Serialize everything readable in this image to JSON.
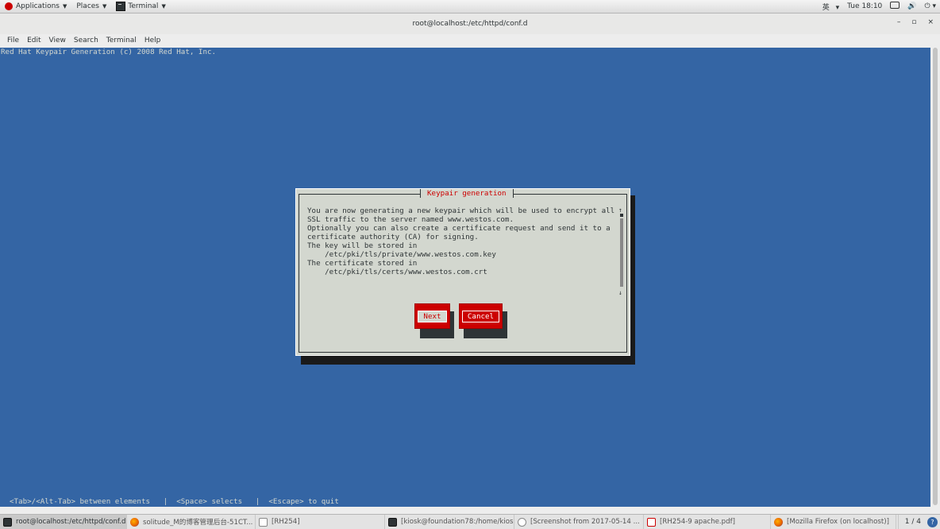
{
  "topbar": {
    "applications": "Applications",
    "places": "Places",
    "terminal": "Terminal",
    "input_method": "英",
    "clock": "Tue 18:10"
  },
  "window": {
    "title": "root@localhost:/etc/httpd/conf.d",
    "minimize": "–",
    "maximize": "▫",
    "close": "×"
  },
  "menubar": {
    "items": [
      "File",
      "Edit",
      "View",
      "Search",
      "Terminal",
      "Help"
    ]
  },
  "terminal": {
    "header": "Red Hat Keypair Generation (c) 2008 Red Hat, Inc.",
    "footer": "<Tab>/<Alt-Tab> between elements   |  <Space> selects   |  <Escape> to quit",
    "bg_color": "#3465a4"
  },
  "dialog": {
    "title": "Keypair generation",
    "lines": [
      "You are now generating a new keypair which will be used to encrypt all",
      "SSL traffic to the server named www.westos.com.",
      "Optionally you can also create a certificate request and send it to a",
      "certificate authority (CA) for signing.",
      "",
      "The key will be stored in",
      "    /etc/pki/tls/private/www.westos.com.key",
      "The certificate stored in",
      "    /etc/pki/tls/certs/www.westos.com.crt"
    ],
    "next_label": "Next",
    "cancel_label": "Cancel",
    "button_color": "#cc0000"
  },
  "taskbar": {
    "tasks": [
      "root@localhost:/etc/httpd/conf.d",
      "solitude_M的博客管理后台-51CT...",
      "[RH254]",
      "[kiosk@foundation78:/home/kios...",
      "[Screenshot from 2017-05-14 ...",
      "[RH254-9 apache.pdf]",
      "[Mozilla Firefox (on localhost)]"
    ],
    "pager": "1 / 4"
  }
}
